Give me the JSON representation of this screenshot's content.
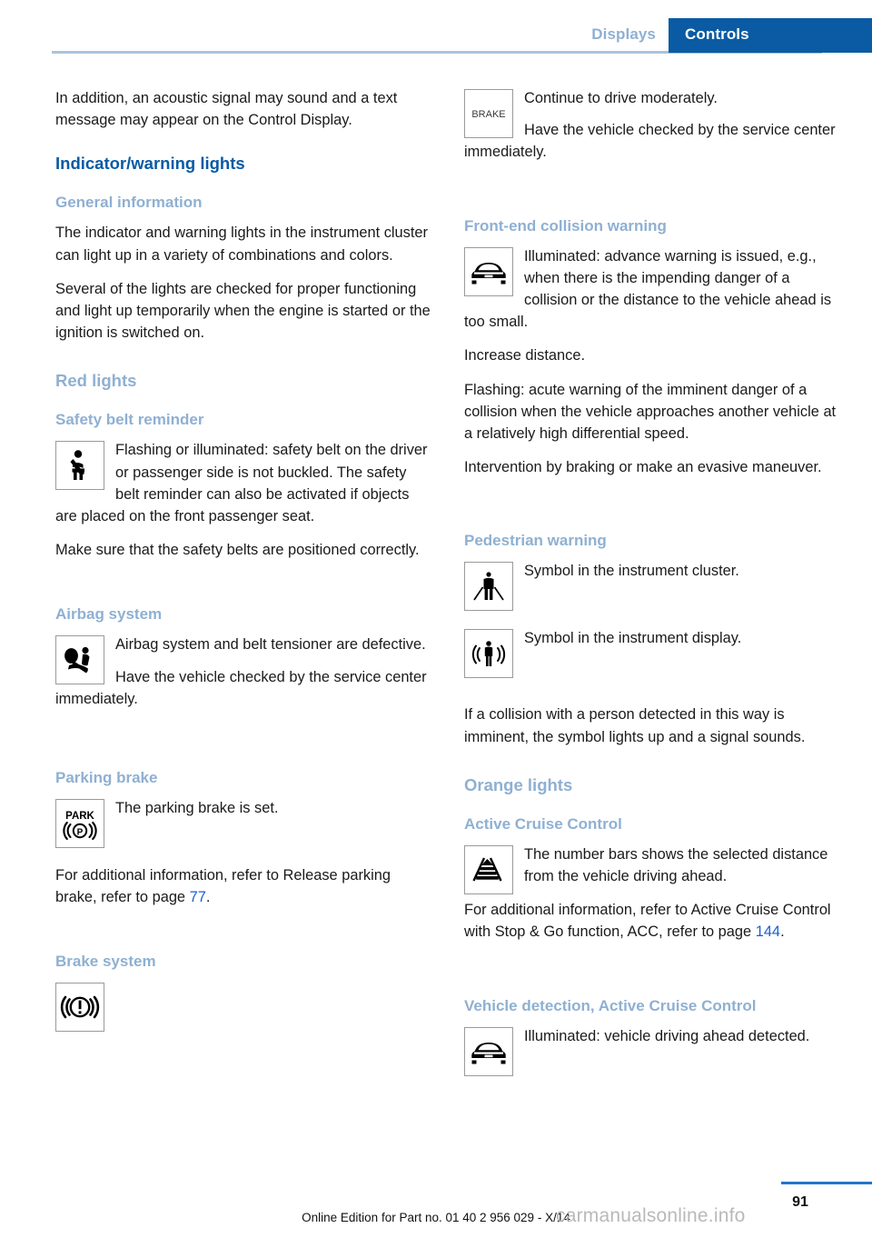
{
  "header": {
    "tab_inactive": "Displays",
    "tab_active": "Controls",
    "accent_dark": "#0a5ba3",
    "accent_light": "#8fb0d2",
    "rule_color": "#a9c3dd"
  },
  "left_column": {
    "intro_paragraph": "In addition, an acoustic signal may sound and a text message may appear on the Control Display.",
    "main_heading": "Indicator/warning lights",
    "general_information": {
      "heading": "General information",
      "paragraph_1": "The indicator and warning lights in the instrument cluster can light up in a variety of combinations and colors.",
      "paragraph_2": "Several of the lights are checked for proper functioning and light up temporarily when the engine is started or the ignition is switched on."
    },
    "red_lights_heading": "Red lights",
    "safety_belt": {
      "heading": "Safety belt reminder",
      "icon": "seatbelt-reminder-icon",
      "paragraph_1": "Flashing or illuminated: safety belt on the driver or passenger side is not buckled. The safety belt reminder can also be activated if objects are placed on the front passenger seat.",
      "paragraph_2": "Make sure that the safety belts are positioned correctly."
    },
    "airbag": {
      "heading": "Airbag system",
      "icon": "airbag-system-icon",
      "paragraph_1": "Airbag system and belt tensioner are defective.",
      "paragraph_2": "Have the vehicle checked by the service center immediately."
    },
    "parking_brake": {
      "heading": "Parking brake",
      "icon": "park-brake-icon",
      "icon_text_top": "PARK",
      "icon_text_bottom": "P",
      "paragraph_1": "The parking brake is set.",
      "paragraph_2_before": "For additional information, refer to Release parking brake, refer to page ",
      "paragraph_2_page_ref": "77",
      "paragraph_2_after": "."
    },
    "brake_system": {
      "heading": "Brake system",
      "icon": "brake-warning-icon"
    }
  },
  "right_column": {
    "brake_continued": {
      "icon": "brake-text-icon",
      "icon_text": "BRAKE",
      "paragraph_1": "Continue to drive moderately.",
      "paragraph_2": "Have the vehicle checked by the service center immediately."
    },
    "front_end_collision": {
      "heading": "Front-end collision warning",
      "icon": "car-front-collision-icon",
      "paragraph_1": "Illuminated: advance warning is issued, e.g., when there is the impending danger of a collision or the distance to the vehicle ahead is too small.",
      "paragraph_2": "Increase distance.",
      "paragraph_3": "Flashing: acute warning of the imminent danger of a collision when the vehicle approaches another vehicle at a relatively high differential speed.",
      "paragraph_4": "Intervention by braking or make an evasive maneuver."
    },
    "pedestrian_warning": {
      "heading": "Pedestrian warning",
      "icon_cluster": "pedestrian-cluster-icon",
      "text_cluster": "Symbol in the instrument cluster.",
      "icon_display": "pedestrian-display-icon",
      "text_display": "Symbol in the instrument display.",
      "paragraph_1": "If a collision with a person detected in this way is imminent, the symbol lights up and a signal sounds."
    },
    "orange_lights_heading": "Orange lights",
    "active_cruise_control": {
      "heading": "Active Cruise Control",
      "icon": "acc-distance-bars-icon",
      "paragraph_1": "The number bars shows the selected distance from the vehicle driving ahead.",
      "paragraph_2_before": "For additional information, refer to Active Cruise Control with Stop & Go function, ACC, refer to page ",
      "paragraph_2_page_ref": "144",
      "paragraph_2_after": "."
    },
    "vehicle_detection": {
      "heading": "Vehicle detection, Active Cruise Control",
      "icon": "car-front-detected-icon",
      "paragraph_1": "Illuminated: vehicle driving ahead detected."
    }
  },
  "footer": {
    "page_number": "91",
    "edition_line": "Online Edition for Part no. 01 40 2 956 029 - X/14",
    "watermark": "carmanualsonline.info",
    "rule_color": "#2277c8"
  }
}
